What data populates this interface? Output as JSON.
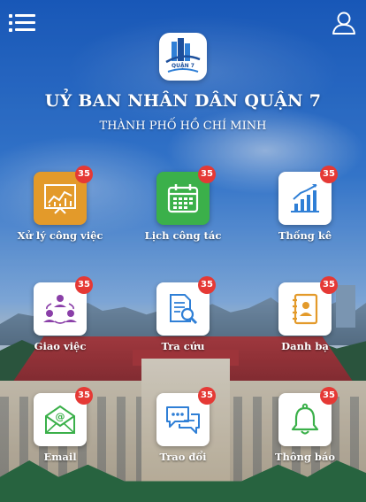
{
  "header": {
    "menu_icon": "hamburger-menu-icon",
    "user_icon": "user-icon",
    "logo_text": "QUẬN 7",
    "title": "UỶ BAN NHÂN DÂN QUẬN 7",
    "subtitle": "THÀNH PHỐ HỒ CHÍ MINH"
  },
  "tiles": [
    {
      "label": "Xử lý công việc",
      "badge": "35",
      "icon": "chart-board-icon",
      "color": "#e39a2a"
    },
    {
      "label": "Lịch công tác",
      "badge": "35",
      "icon": "calendar-icon",
      "color": "#3bb04a"
    },
    {
      "label": "Thống kê",
      "badge": "35",
      "icon": "bar-chart-icon",
      "color": "#ffffff"
    },
    {
      "label": "Giao việc",
      "badge": "35",
      "icon": "team-assign-icon",
      "color": "#ffffff"
    },
    {
      "label": "Tra cứu",
      "badge": "35",
      "icon": "document-search-icon",
      "color": "#ffffff"
    },
    {
      "label": "Danh bạ",
      "badge": "35",
      "icon": "contact-book-icon",
      "color": "#ffffff"
    },
    {
      "label": "Email",
      "badge": "35",
      "icon": "email-icon",
      "color": "#ffffff"
    },
    {
      "label": "Trao đổi",
      "badge": "35",
      "icon": "chat-icon",
      "color": "#ffffff"
    },
    {
      "label": "Thông báo",
      "badge": "35",
      "icon": "bell-icon",
      "color": "#ffffff"
    }
  ],
  "colors": {
    "badge": "#e53935",
    "accent_blue": "#2f7fd6",
    "sky": "#1b5ec4"
  }
}
